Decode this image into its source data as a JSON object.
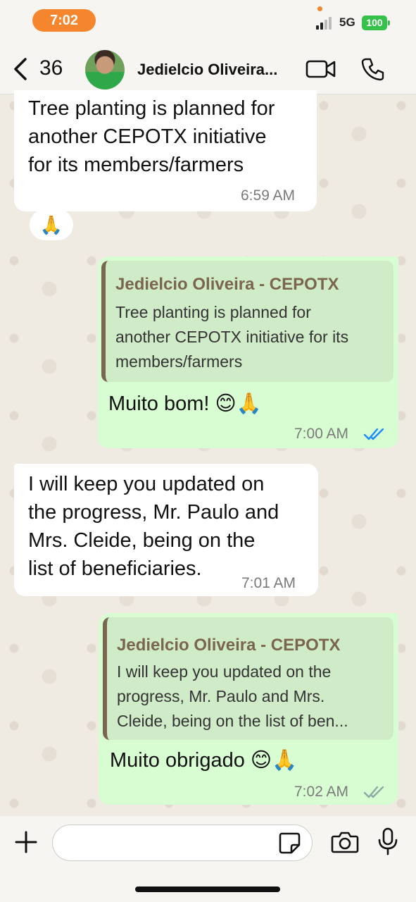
{
  "status_bar": {
    "time": "7:02",
    "network": "5G",
    "battery": "100"
  },
  "header": {
    "back_count": "36",
    "contact_name": "Jedielcio Oliveira..."
  },
  "messages": [
    {
      "direction": "incoming",
      "lines": [
        "Tree planting is planned for",
        "another CEPOTX initiative",
        "for its members/farmers"
      ],
      "time": "6:59 AM",
      "reaction": "🙏"
    },
    {
      "direction": "outgoing",
      "quote_author": "Jedielcio Oliveira - CEPOTX",
      "quote_lines": [
        "Tree planting is planned for",
        "another CEPOTX initiative for its",
        "members/farmers"
      ],
      "text": "Muito bom! 😊🙏",
      "time": "7:00 AM",
      "status": "read"
    },
    {
      "direction": "incoming",
      "lines": [
        "I will keep you updated on",
        "the progress, Mr. Paulo and",
        "Mrs. Cleide, being on the",
        "list of beneficiaries."
      ],
      "time": "7:01 AM"
    },
    {
      "direction": "outgoing",
      "quote_author": "Jedielcio Oliveira - CEPOTX",
      "quote_lines": [
        "I will keep you updated on the",
        "progress, Mr. Paulo and Mrs.",
        "Cleide, being on the list of ben..."
      ],
      "text": "Muito obrigado 😊🙏",
      "time": "7:02 AM",
      "status": "delivered"
    }
  ],
  "composer": {
    "value": "",
    "placeholder": ""
  },
  "icons": {
    "read_tick_color": "#1a8cff",
    "delivered_tick_color": "#8fa9a4",
    "accent": "#f5862d"
  }
}
